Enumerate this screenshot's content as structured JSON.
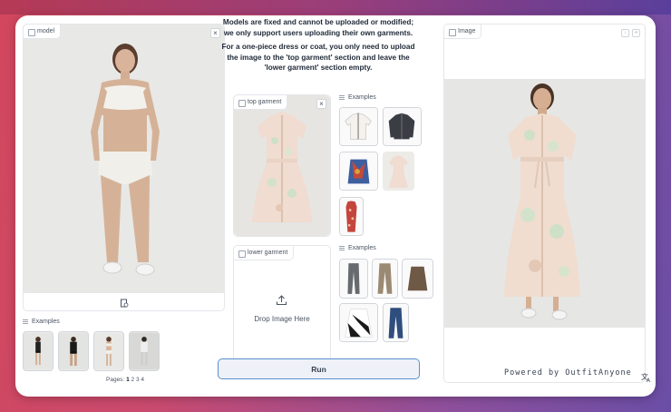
{
  "model_panel": {
    "label": "model",
    "close_symbol": "×",
    "upload_icon": "upload-file-icon",
    "examples_label": "Examples",
    "pages_label": "Pages:",
    "pages": [
      "1",
      "2",
      "3",
      "4"
    ]
  },
  "notice": {
    "line1": "Models are fixed and cannot be uploaded or modified; we only support users uploading their own garments.",
    "line2": "For a one-piece dress or coat, you only need to upload the image to the 'top garment' section and leave the 'lower garment' section empty."
  },
  "top_garment": {
    "label": "top garment",
    "close_symbol": "×",
    "examples_label": "Examples"
  },
  "lower_garment": {
    "label": "lower garment",
    "drop_text": "Drop Image Here",
    "upload_icon": "upload-icon",
    "examples_label": "Examples"
  },
  "image_panel": {
    "label": "Image",
    "download_icon": "download-icon",
    "share_icon": "share-icon",
    "watermark": "Powered by OutfitAnyone"
  },
  "run_button": {
    "label": "Run"
  },
  "floating_icon": "translate-icon",
  "colors": {
    "accent_border": "#5b8fd1",
    "run_bg": "#eef1f8"
  }
}
